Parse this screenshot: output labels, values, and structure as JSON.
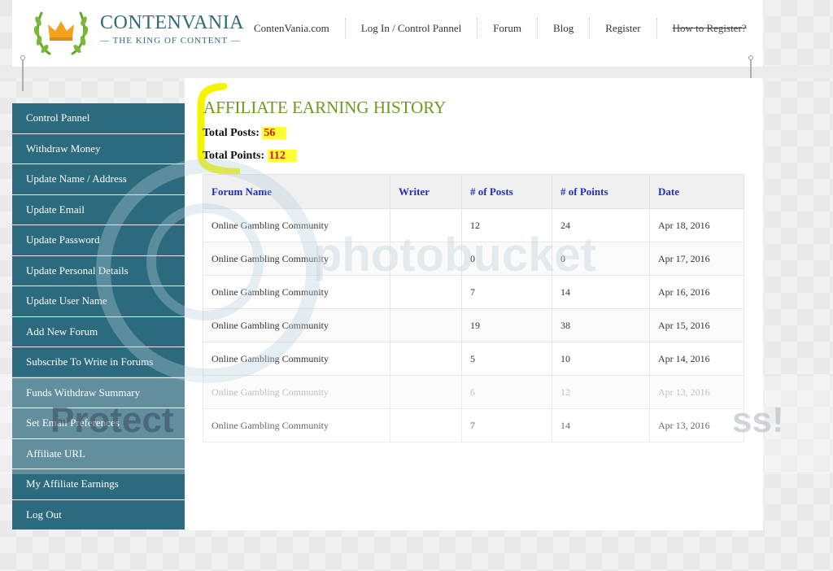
{
  "brand": {
    "name": "CONTENVANIA",
    "tagline": "THE KING OF CONTENT"
  },
  "topnav": [
    {
      "label": "ContenVania.com"
    },
    {
      "label": "Log In / Control Pannel"
    },
    {
      "label": "Forum"
    },
    {
      "label": "Blog"
    },
    {
      "label": "Register"
    },
    {
      "label": "How to Register?"
    }
  ],
  "sidebar": {
    "items": [
      {
        "label": "Control Pannel"
      },
      {
        "label": "Withdraw Money"
      },
      {
        "label": "Update Name / Address"
      },
      {
        "label": "Update Email"
      },
      {
        "label": "Update Password"
      },
      {
        "label": "Update Personal Details"
      },
      {
        "label": "Update User Name"
      },
      {
        "label": "Add New Forum"
      },
      {
        "label": "Subscribe To Write in Forums"
      },
      {
        "label": "Funds Withdraw Summary"
      },
      {
        "label": "Set Email Preferences"
      },
      {
        "label": "Affiliate URL"
      },
      {
        "label": "My Affiliate Earnings"
      },
      {
        "label": "Log Out"
      }
    ]
  },
  "main": {
    "title": "AFFILIATE EARNING HISTORY",
    "total_posts_label": "Total Posts:",
    "total_posts_value": "56",
    "total_points_label": "Total Points:",
    "total_points_value": "112"
  },
  "table": {
    "headers": [
      "Forum Name",
      "Writer",
      "# of Posts",
      "# of Points",
      "Date"
    ],
    "rows": [
      [
        "Online Gambling Community",
        "",
        "12",
        "24",
        "Apr 18, 2016"
      ],
      [
        "Online Gambling Community",
        "",
        "0",
        "0",
        "Apr 17, 2016"
      ],
      [
        "Online Gambling Community",
        "",
        "7",
        "14",
        "Apr 16, 2016"
      ],
      [
        "Online Gambling Community",
        "",
        "19",
        "38",
        "Apr 15, 2016"
      ],
      [
        "Online Gambling Community",
        "",
        "5",
        "10",
        "Apr 14, 2016"
      ],
      [
        "Online Gambling Community",
        "",
        "6",
        "12",
        "Apr 13, 2016"
      ],
      [
        "Online Gambling Community",
        "",
        "7",
        "14",
        "Apr 13, 2016"
      ]
    ]
  },
  "watermark": {
    "left": "Protect",
    "right": "ss!",
    "center": "photobucket"
  },
  "colors": {
    "sidebar": "#2c6a7e",
    "title": "#6a9a1f",
    "header_link": "#1f2fbf",
    "highlight": "#ffff33",
    "value": "#d41616"
  }
}
